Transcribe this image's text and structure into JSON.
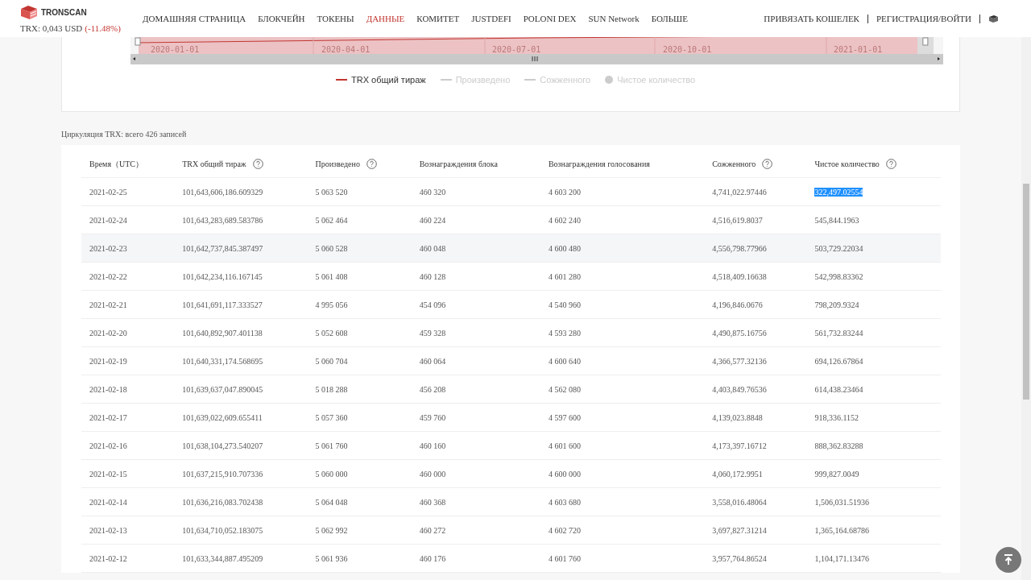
{
  "header": {
    "brand": "TRONSCAN",
    "price": "TRX: 0,043 USD",
    "change": "(-11.48%)",
    "nav": [
      {
        "label": "ДОМАШНЯЯ СТРАНИЦА",
        "selected": false
      },
      {
        "label": "БЛОКЧЕЙН",
        "selected": false
      },
      {
        "label": "ТОКЕНЫ",
        "selected": false
      },
      {
        "label": "ДАННЫЕ",
        "selected": true
      },
      {
        "label": "КОМИТЕТ",
        "selected": false
      },
      {
        "label": "JUSTDEFI",
        "selected": false
      },
      {
        "label": "POLONI DEX",
        "selected": false
      },
      {
        "label": "SUN Network",
        "selected": false
      },
      {
        "label": "БОЛЬШЕ",
        "selected": false
      }
    ],
    "actions": [
      "ПРИВЯЗАТЬ КОШЕЛЕК",
      "РЕГИСТРАЦИЯ/ВОЙТИ"
    ]
  },
  "chart": {
    "slider_window": {
      "level": 0.98
    },
    "slider_labels": [
      "2020-01-01",
      "2020-04-01",
      "2020-07-01",
      "2020-10-01",
      "2021-01-01"
    ],
    "legend": [
      {
        "label": "TRX общий тираж",
        "active": true,
        "kind": "line"
      },
      {
        "label": "Произведено",
        "active": false,
        "kind": "line"
      },
      {
        "label": "Сожженного",
        "active": false,
        "kind": "line"
      },
      {
        "label": "Чистое количество",
        "active": false,
        "kind": "dot"
      }
    ]
  },
  "caption": "Циркуляция TRX: всего 426 записей",
  "table": {
    "columns": [
      {
        "label": "Время（UTC）",
        "help": false
      },
      {
        "label": "TRX общий тираж",
        "help": true
      },
      {
        "label": "Произведено",
        "help": true
      },
      {
        "label": "Вознаграждения блока",
        "help": false
      },
      {
        "label": "Вознаграждения голосования",
        "help": false
      },
      {
        "label": "Сожженного",
        "help": true
      },
      {
        "label": "Чистое количество",
        "help": true
      }
    ],
    "rows": [
      {
        "hovered": false,
        "text_selected": true,
        "cells": [
          "2021-02-25",
          "101,643,606,186.609329",
          "5 063 520",
          "460 320",
          "4 603 200",
          "4,741,022.97446",
          "322,497.02554"
        ]
      },
      {
        "hovered": false,
        "text_selected": false,
        "cells": [
          "2021-02-24",
          "101,643,283,689.583786",
          "5 062 464",
          "460 224",
          "4 602 240",
          "4,516,619.8037",
          "545,844.1963"
        ]
      },
      {
        "hovered": true,
        "text_selected": false,
        "cells": [
          "2021-02-23",
          "101,642,737,845.387497",
          "5 060 528",
          "460 048",
          "4 600 480",
          "4,556,798.77966",
          "503,729.22034"
        ]
      },
      {
        "hovered": false,
        "text_selected": false,
        "cells": [
          "2021-02-22",
          "101,642,234,116.167145",
          "5 061 408",
          "460 128",
          "4 601 280",
          "4,518,409.16638",
          "542,998.83362"
        ]
      },
      {
        "hovered": false,
        "text_selected": false,
        "cells": [
          "2021-02-21",
          "101,641,691,117.333527",
          "4 995 056",
          "454 096",
          "4 540 960",
          "4,196,846.0676",
          "798,209.9324"
        ]
      },
      {
        "hovered": false,
        "text_selected": false,
        "cells": [
          "2021-02-20",
          "101,640,892,907.401138",
          "5 052 608",
          "459 328",
          "4 593 280",
          "4,490,875.16756",
          "561,732.83244"
        ]
      },
      {
        "hovered": false,
        "text_selected": false,
        "cells": [
          "2021-02-19",
          "101,640,331,174.568695",
          "5 060 704",
          "460 064",
          "4 600 640",
          "4,366,577.32136",
          "694,126.67864"
        ]
      },
      {
        "hovered": false,
        "text_selected": false,
        "cells": [
          "2021-02-18",
          "101,639,637,047.890045",
          "5 018 288",
          "456 208",
          "4 562 080",
          "4,403,849.76536",
          "614,438.23464"
        ]
      },
      {
        "hovered": false,
        "text_selected": false,
        "cells": [
          "2021-02-17",
          "101,639,022,609.655411",
          "5 057 360",
          "459 760",
          "4 597 600",
          "4,139,023.8848",
          "918,336.1152"
        ]
      },
      {
        "hovered": false,
        "text_selected": false,
        "cells": [
          "2021-02-16",
          "101,638,104,273.540207",
          "5 061 760",
          "460 160",
          "4 601 600",
          "4,173,397.16712",
          "888,362.83288"
        ]
      },
      {
        "hovered": false,
        "text_selected": false,
        "cells": [
          "2021-02-15",
          "101,637,215,910.707336",
          "5 060 000",
          "460 000",
          "4 600 000",
          "4,060,172.9951",
          "999,827.0049"
        ]
      },
      {
        "hovered": false,
        "text_selected": false,
        "cells": [
          "2021-02-14",
          "101,636,216,083.702438",
          "5 064 048",
          "460 368",
          "4 603 680",
          "3,558,016.48064",
          "1,506,031.51936"
        ]
      },
      {
        "hovered": false,
        "text_selected": false,
        "cells": [
          "2021-02-13",
          "101,634,710,052.183075",
          "5 062 992",
          "460 272",
          "4 602 720",
          "3,697,827.31214",
          "1,365,164.68786"
        ]
      },
      {
        "hovered": false,
        "text_selected": false,
        "cells": [
          "2021-02-12",
          "101,633,344,887.495209",
          "5 061 936",
          "460 176",
          "4 601 760",
          "3,957,764.86524",
          "1,104,171.13476"
        ]
      }
    ]
  }
}
